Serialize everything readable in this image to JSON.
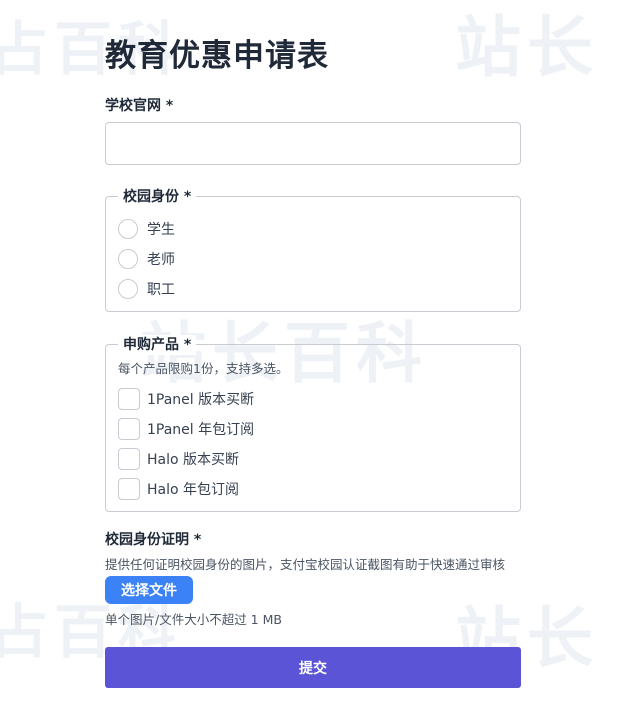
{
  "watermark": {
    "text_a": "占百科",
    "text_b": "站长",
    "text_c": "站长百科"
  },
  "form": {
    "title": "教育优惠申请表",
    "website": {
      "label": "学校官网 *",
      "value": "",
      "placeholder": ""
    },
    "identity": {
      "legend": "校园身份 *",
      "options": [
        "学生",
        "老师",
        "职工"
      ]
    },
    "products": {
      "legend": "申购产品 *",
      "hint": "每个产品限购1份，支持多选。",
      "options": [
        "1Panel 版本买断",
        "1Panel 年包订阅",
        "Halo 版本买断",
        "Halo 年包订阅"
      ]
    },
    "proof": {
      "label": "校园身份证明 *",
      "hint": "提供任何证明校园身份的图片，支付宝校园认证截图有助于快速通过审核",
      "button_label": "选择文件",
      "size_note": "单个图片/文件大小不超过 1 MB"
    },
    "submit_label": "提交"
  }
}
